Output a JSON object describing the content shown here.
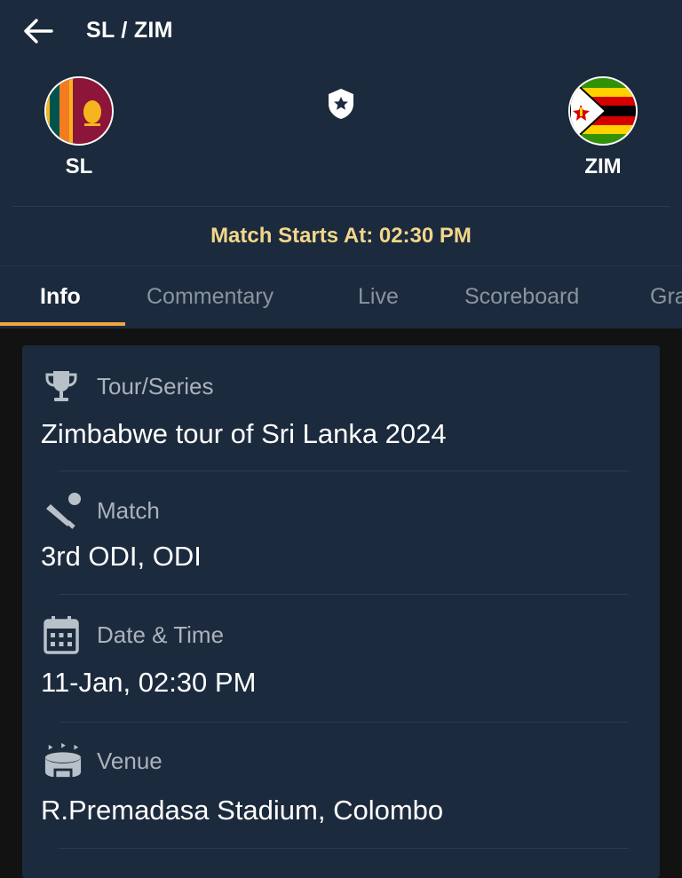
{
  "header": {
    "title": "SL / ZIM",
    "back_icon": "arrow-left-icon",
    "favorite_icon": "shield-star-icon"
  },
  "teams": {
    "home": {
      "label": "SL",
      "flag": "sri-lanka-flag"
    },
    "away": {
      "label": "ZIM",
      "flag": "zimbabwe-flag"
    }
  },
  "match_start": "Match Starts At: 02:30 PM",
  "tabs": [
    {
      "label": "Info",
      "active": true
    },
    {
      "label": "Commentary"
    },
    {
      "label": "Live"
    },
    {
      "label": "Scoreboard"
    },
    {
      "label": "Gra"
    }
  ],
  "info": [
    {
      "icon": "trophy-icon",
      "label": "Tour/Series",
      "value": "Zimbabwe tour of Sri Lanka 2024"
    },
    {
      "icon": "cricket-bat-ball-icon",
      "label": "Match",
      "value": "3rd ODI, ODI"
    },
    {
      "icon": "calendar-icon",
      "label": "Date & Time",
      "value": "11-Jan, 02:30 PM"
    },
    {
      "icon": "stadium-icon",
      "label": "Venue",
      "value": "R.Premadasa Stadium, Colombo"
    }
  ],
  "colors": {
    "header_bg": "#1c2a3d",
    "page_bg": "#121212",
    "accent": "#f0a63c",
    "match_start_text": "#f2d78a"
  }
}
